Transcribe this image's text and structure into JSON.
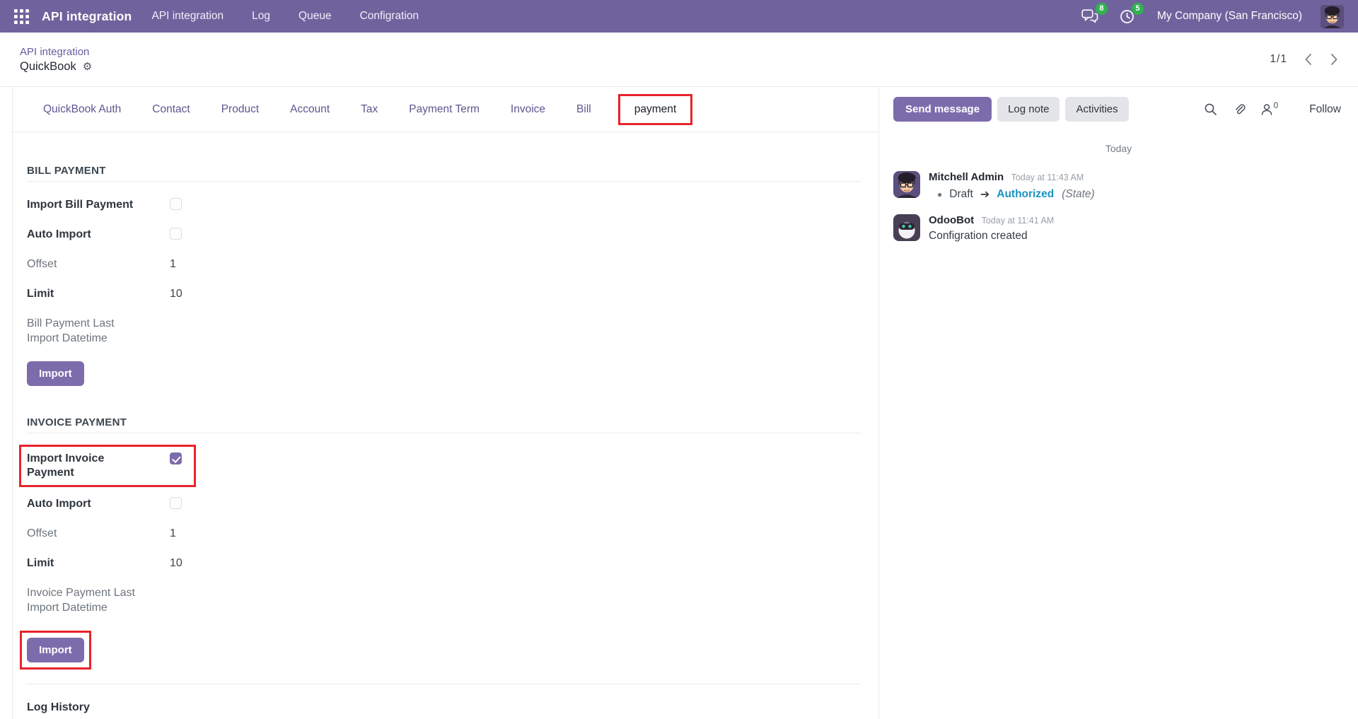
{
  "colors": {
    "topbar": "#70639d",
    "accent": "#7d6cac",
    "annotation": "#e8232b",
    "link": "#6a5b9e",
    "tab": "#5f558f",
    "trackingnew": "#1a93c1",
    "badge": "#30b34e"
  },
  "topbar": {
    "app_title": "API integration",
    "menu": {
      "root": "API integration",
      "log": "Log",
      "queue": "Queue",
      "configuration": "Configration"
    },
    "messages_badge": "8",
    "activities_badge": "5",
    "company": "My Company (San Francisco)"
  },
  "breadcrumb": {
    "parent": "API integration",
    "current": "QuickBook",
    "pager": "1/1"
  },
  "tabs": [
    {
      "label": "QuickBook Auth"
    },
    {
      "label": "Contact"
    },
    {
      "label": "Product"
    },
    {
      "label": "Account"
    },
    {
      "label": "Tax"
    },
    {
      "label": "Payment Term"
    },
    {
      "label": "Invoice"
    },
    {
      "label": "Bill"
    },
    {
      "label": "payment",
      "active": true
    }
  ],
  "form": {
    "bill": {
      "title": "BILL PAYMENT",
      "import_label": "Import Bill Payment",
      "import_checked": false,
      "auto_label": "Auto Import",
      "auto_checked": false,
      "offset_label": "Offset",
      "offset_value": "1",
      "limit_label": "Limit",
      "limit_value": "10",
      "last_import_label": "Bill Payment Last Import Datetime",
      "import_button": "Import"
    },
    "invoice": {
      "title": "INVOICE PAYMENT",
      "import_label": "Import Invoice Payment",
      "import_checked": true,
      "auto_label": "Auto Import",
      "auto_checked": false,
      "offset_label": "Offset",
      "offset_value": "1",
      "limit_label": "Limit",
      "limit_value": "10",
      "last_import_label": "Invoice Payment Last Import Datetime",
      "import_button": "Import"
    },
    "log_history": "Log History"
  },
  "chatter": {
    "send_message": "Send message",
    "log_note": "Log note",
    "activities": "Activities",
    "followers_count": "0",
    "follow": "Follow",
    "date_divider": "Today",
    "messages": [
      {
        "author": "Mitchell Admin",
        "time": "Today at 11:43 AM",
        "tracking_from": "Draft",
        "tracking_to": "Authorized",
        "tracking_field": "(State)"
      },
      {
        "author": "OdooBot",
        "time": "Today at 11:41 AM",
        "body": "Configration created"
      }
    ]
  }
}
